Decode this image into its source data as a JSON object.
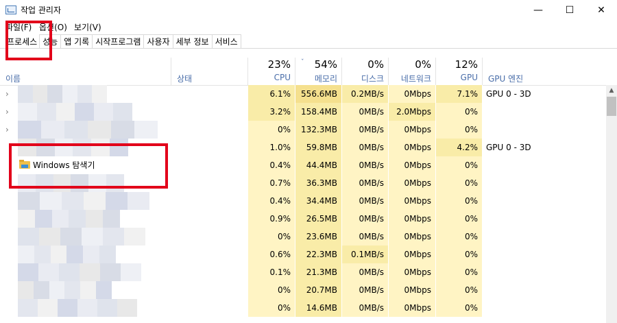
{
  "window": {
    "title": "작업 관리자",
    "minimize_glyph": "—",
    "maximize_glyph": "☐",
    "close_glyph": "✕"
  },
  "menu": {
    "file": "파일(F)",
    "options": "옵션(O)",
    "view": "보기(V)"
  },
  "tabs": [
    "프로세스",
    "성능",
    "앱 기록",
    "시작프로그램",
    "사용자",
    "세부 정보",
    "서비스"
  ],
  "header": {
    "name": "이름",
    "status": "상태",
    "cpu": {
      "pct": "23%",
      "label": "CPU"
    },
    "memory": {
      "pct": "54%",
      "label": "메모리"
    },
    "disk": {
      "pct": "0%",
      "label": "디스크"
    },
    "network": {
      "pct": "0%",
      "label": "네트워크"
    },
    "gpu": {
      "pct": "12%",
      "label": "GPU"
    },
    "gpu_engine": "GPU 엔진",
    "sort_glyph": "ˇ"
  },
  "rows": [
    {
      "expand": "›",
      "name": "",
      "cpu": "6.1%",
      "mem": "556.6MB",
      "disk": "0.2MB/s",
      "net": "0Mbps",
      "gpu": "7.1%",
      "engine": "GPU 0 - 3D"
    },
    {
      "expand": "›",
      "name": "",
      "cpu": "3.2%",
      "mem": "158.4MB",
      "disk": "0MB/s",
      "net": "2.0Mbps",
      "gpu": "0%",
      "engine": ""
    },
    {
      "expand": "›",
      "name": "",
      "cpu": "0%",
      "mem": "132.3MB",
      "disk": "0MB/s",
      "net": "0Mbps",
      "gpu": "0%",
      "engine": ""
    },
    {
      "expand": "",
      "name": "",
      "cpu": "1.0%",
      "mem": "59.8MB",
      "disk": "0MB/s",
      "net": "0Mbps",
      "gpu": "4.2%",
      "engine": "GPU 0 - 3D"
    },
    {
      "expand": "",
      "name": "Windows 탐색기",
      "cpu": "0.4%",
      "mem": "44.4MB",
      "disk": "0MB/s",
      "net": "0Mbps",
      "gpu": "0%",
      "engine": ""
    },
    {
      "expand": "",
      "name": "",
      "cpu": "0.7%",
      "mem": "36.3MB",
      "disk": "0MB/s",
      "net": "0Mbps",
      "gpu": "0%",
      "engine": ""
    },
    {
      "expand": "",
      "name": "",
      "cpu": "0.4%",
      "mem": "34.4MB",
      "disk": "0MB/s",
      "net": "0Mbps",
      "gpu": "0%",
      "engine": ""
    },
    {
      "expand": "",
      "name": "",
      "cpu": "0.9%",
      "mem": "26.5MB",
      "disk": "0MB/s",
      "net": "0Mbps",
      "gpu": "0%",
      "engine": ""
    },
    {
      "expand": "",
      "name": "",
      "cpu": "0%",
      "mem": "23.6MB",
      "disk": "0MB/s",
      "net": "0Mbps",
      "gpu": "0%",
      "engine": ""
    },
    {
      "expand": "",
      "name": "",
      "cpu": "0.6%",
      "mem": "22.3MB",
      "disk": "0.1MB/s",
      "net": "0Mbps",
      "gpu": "0%",
      "engine": ""
    },
    {
      "expand": "",
      "name": "",
      "cpu": "0.1%",
      "mem": "21.3MB",
      "disk": "0MB/s",
      "net": "0Mbps",
      "gpu": "0%",
      "engine": ""
    },
    {
      "expand": "",
      "name": "",
      "cpu": "0%",
      "mem": "20.7MB",
      "disk": "0MB/s",
      "net": "0Mbps",
      "gpu": "0%",
      "engine": ""
    },
    {
      "expand": "",
      "name": "",
      "cpu": "0%",
      "mem": "14.6MB",
      "disk": "0MB/s",
      "net": "0Mbps",
      "gpu": "0%",
      "engine": ""
    }
  ],
  "scrollbar": {
    "up_glyph": "▲"
  },
  "colors": {
    "cell_light": "#fff4c4",
    "cell_mid": "#f9eca8",
    "cell_strong": "#f5e08e",
    "header_label": "#4a6ea9",
    "highlight_box": "#e2001a"
  }
}
